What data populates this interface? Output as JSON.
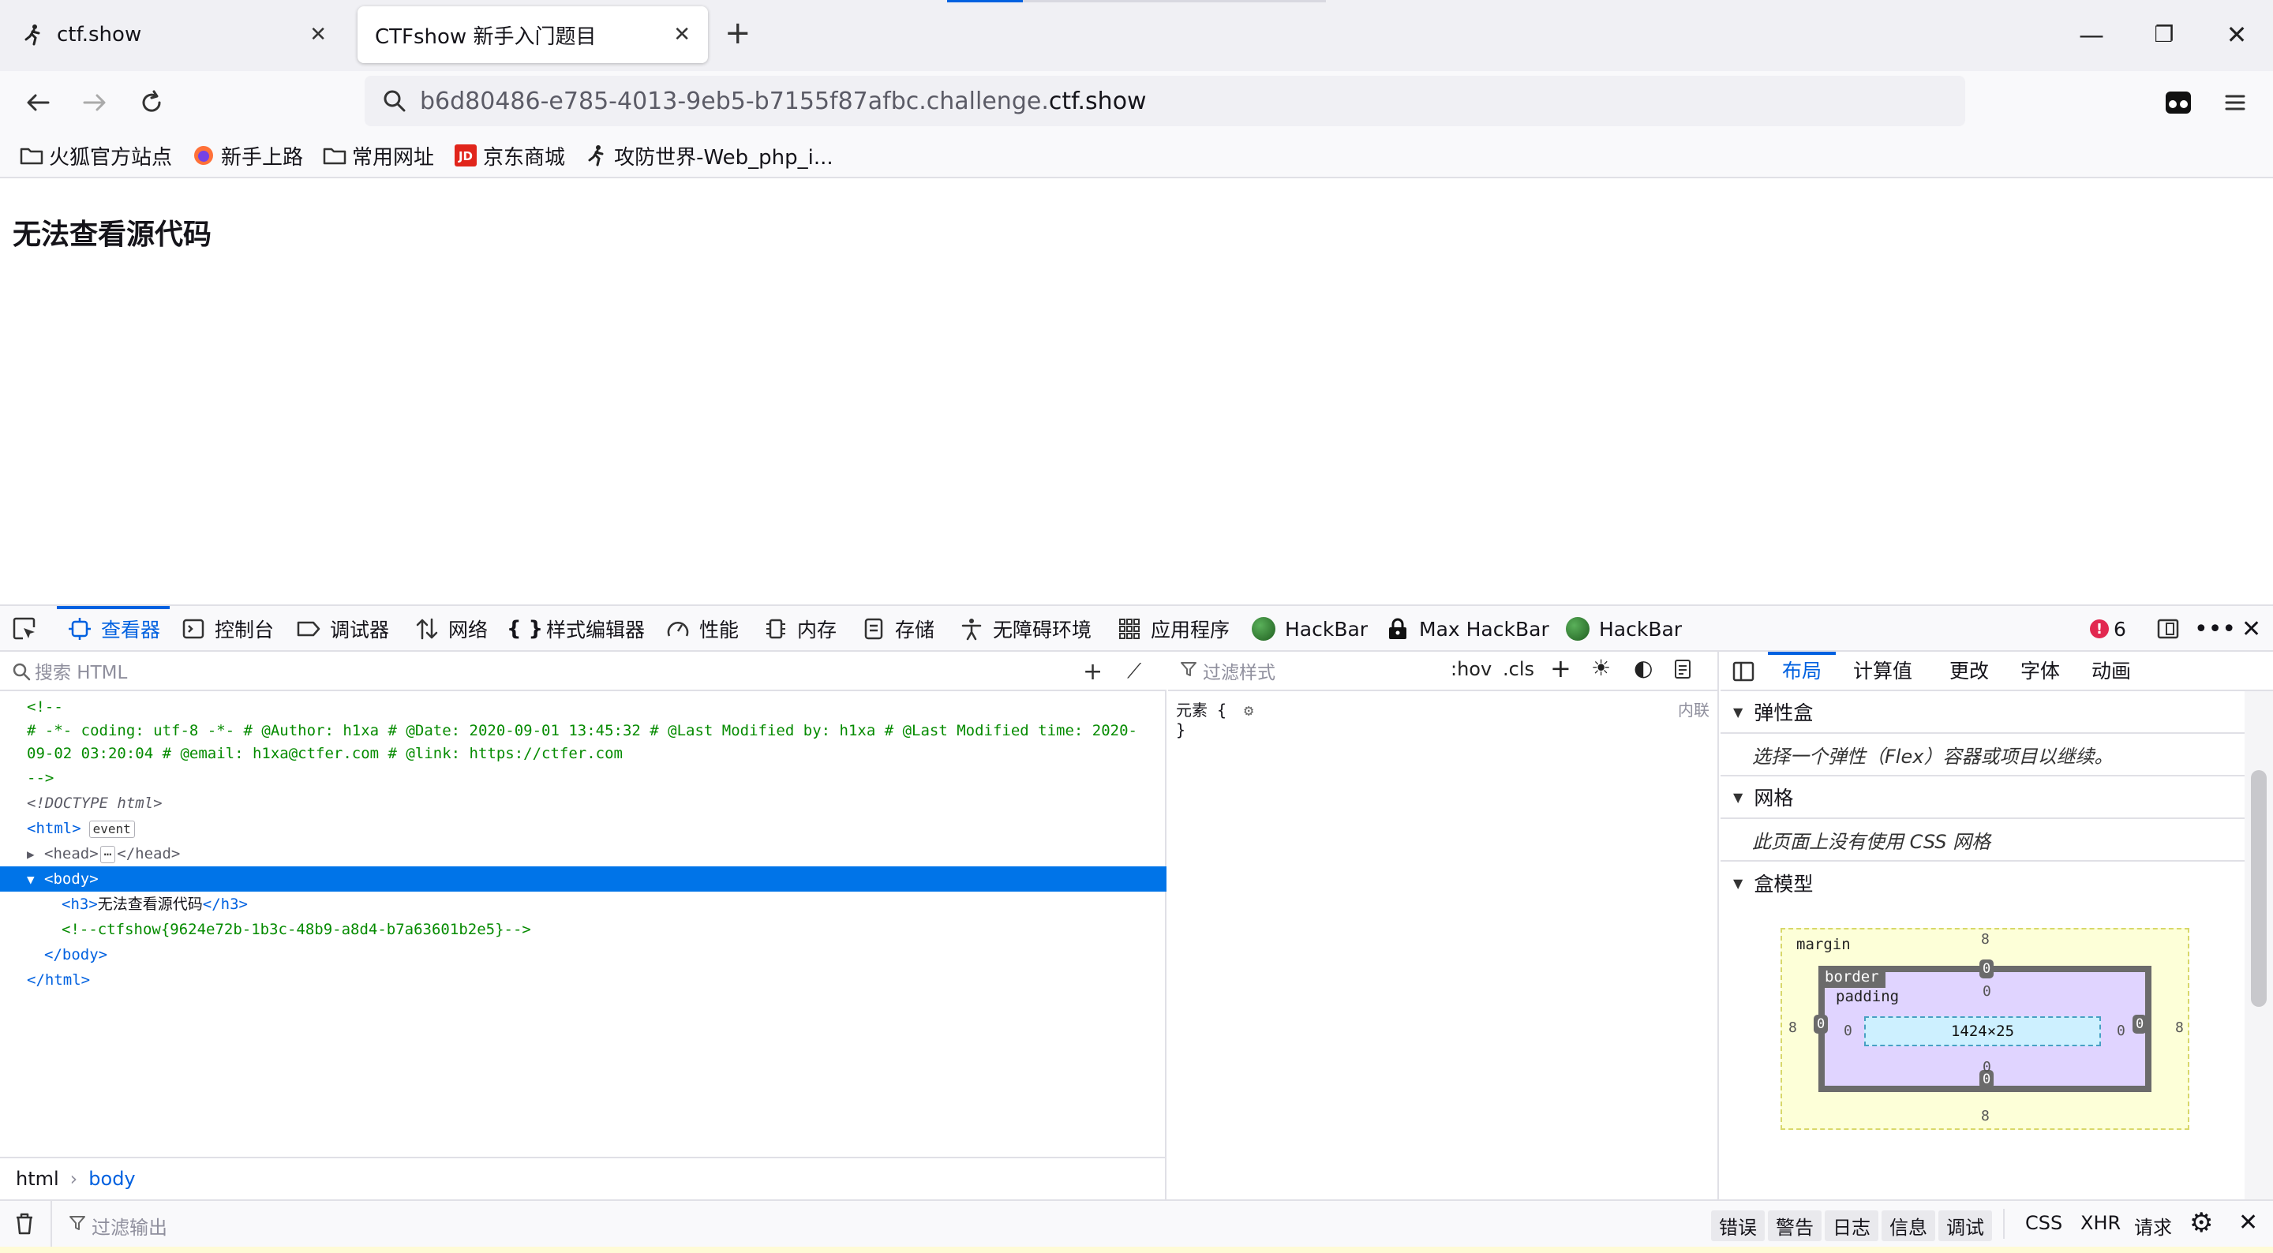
{
  "tabs": [
    {
      "label": "ctf.show",
      "favicon": "runner-icon"
    },
    {
      "label": "CTFshow 新手入门题目",
      "favicon": "none"
    }
  ],
  "window": {
    "minimize": "—",
    "restore": "❐",
    "close": "✕"
  },
  "nav": {
    "url_prefix": "b6d80486-e785-4013-9eb5-b7155f87afbc.challenge.",
    "url_host": "ctf.show"
  },
  "bookmarks": [
    {
      "label": "火狐官方站点",
      "icon": "folder-icon"
    },
    {
      "label": "新手上路",
      "icon": "firefox-icon"
    },
    {
      "label": "常用网址",
      "icon": "folder-icon"
    },
    {
      "label": "京东商城",
      "icon": "jd-icon"
    },
    {
      "label": "攻防世界-Web_php_i...",
      "icon": "runner-icon"
    }
  ],
  "page": {
    "heading": "无法查看源代码"
  },
  "devtools": {
    "tabs": [
      {
        "label": "查看器",
        "icon": "inspector-icon"
      },
      {
        "label": "控制台",
        "icon": "console-icon"
      },
      {
        "label": "调试器",
        "icon": "debugger-icon"
      },
      {
        "label": "网络",
        "icon": "network-icon"
      },
      {
        "label": "样式编辑器",
        "icon": "style-editor-icon"
      },
      {
        "label": "性能",
        "icon": "performance-icon"
      },
      {
        "label": "内存",
        "icon": "memory-icon"
      },
      {
        "label": "存储",
        "icon": "storage-icon"
      },
      {
        "label": "无障碍环境",
        "icon": "accessibility-icon"
      },
      {
        "label": "应用程序",
        "icon": "application-icon"
      },
      {
        "label": "HackBar",
        "icon": "hackbar-icon"
      },
      {
        "label": "Max HackBar",
        "icon": "lock-icon"
      },
      {
        "label": "HackBar",
        "icon": "hackbar-icon"
      }
    ],
    "error_count": "6",
    "html_search_placeholder": "搜索 HTML",
    "markup": {
      "comment_open": "<!--",
      "comment_body": "# -*- coding: utf-8 -*- # @Author: h1xa # @Date: 2020-09-01 13:45:32 # @Last Modified by: h1xa # @Last Modified time: 2020-09-02 03:20:04 # @email: h1xa@ctfer.com # @link: https://ctfer.com",
      "comment_close": "-->",
      "doctype": "<!DOCTYPE html>",
      "html_open": "<html>",
      "event_badge": "event",
      "head_open": "<head>",
      "head_close": "</head>",
      "ellipsis_badge": "⋯",
      "body_open": "<body>",
      "h3_open": "<h3>",
      "h3_text": "无法查看源代码",
      "h3_close": "</h3>",
      "flag_comment": "<!--ctfshow{9624e72b-1b3c-48b9-a8d4-b7a63601b2e5}-->",
      "body_close": "</body>",
      "html_close": "</html>"
    },
    "breadcrumbs": [
      "html",
      "body"
    ],
    "rules": {
      "filter_placeholder": "过滤样式",
      "hov": ":hov",
      "cls": ".cls",
      "element_selector": "元素 {",
      "element_close": "}",
      "source": "内联"
    },
    "layout": {
      "tabs": [
        "布局",
        "计算值",
        "更改",
        "字体",
        "动画"
      ],
      "flexbox_title": "弹性盒",
      "flexbox_text": "选择一个弹性（Flex）容器或项目以继续。",
      "grid_title": "网格",
      "grid_text": "此页面上没有使用 CSS 网格",
      "boxmodel_title": "盒模型",
      "box": {
        "margin_label": "margin",
        "border_label": "border",
        "padding_label": "padding",
        "content_size": "1424×25",
        "margin": {
          "top": "8",
          "right": "8",
          "bottom": "8",
          "left": "8"
        },
        "border": {
          "top": "0",
          "right": "0",
          "bottom": "0",
          "left": "0"
        },
        "padding": {
          "top": "0",
          "right": "0",
          "bottom": "0",
          "left": "0"
        }
      }
    },
    "console": {
      "filter_placeholder": "过滤输出",
      "filters": [
        "错误",
        "警告",
        "日志",
        "信息",
        "调试"
      ],
      "types": [
        "CSS",
        "XHR",
        "请求"
      ]
    }
  },
  "colors": {
    "accent": "#0061e0",
    "selection": "#0074e8",
    "comment": "#058b00",
    "error": "#e22850"
  }
}
